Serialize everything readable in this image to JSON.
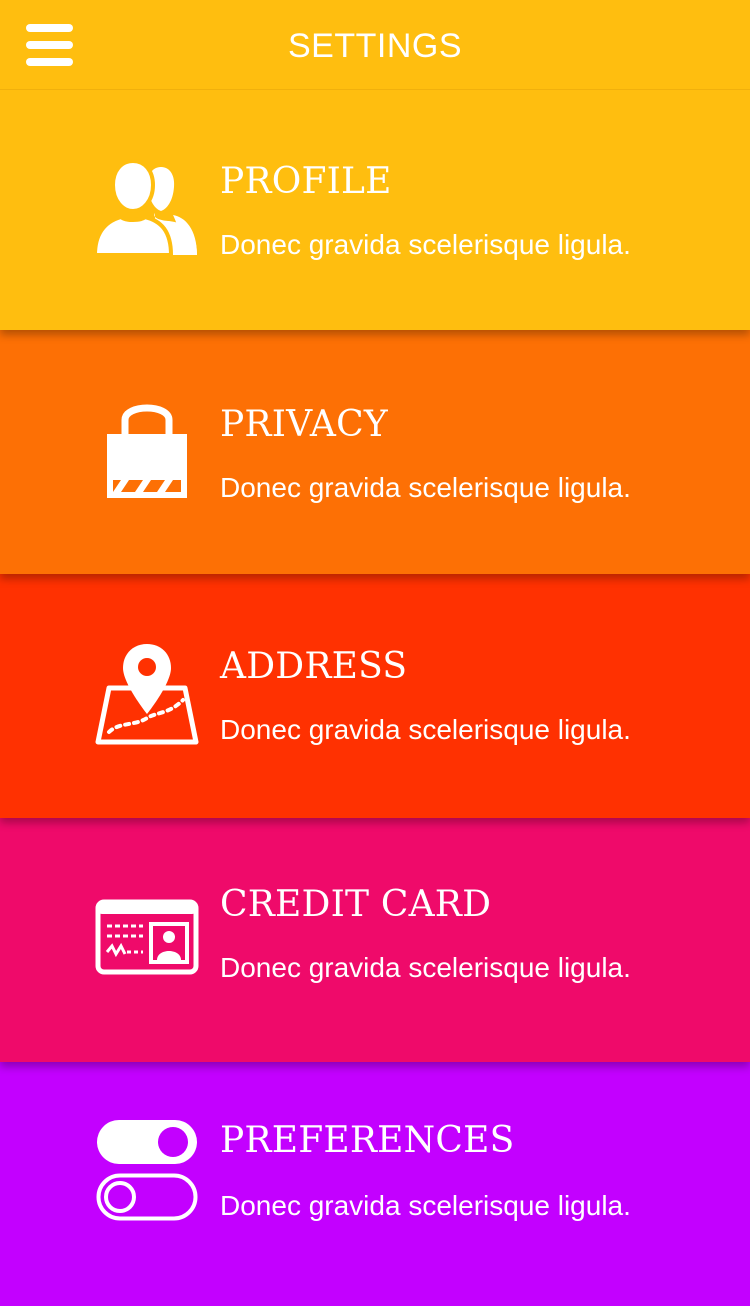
{
  "header": {
    "title": "SETTINGS",
    "menu_icon": "hamburger-menu-icon",
    "background": "#ffbe0f"
  },
  "items": [
    {
      "key": "profile",
      "title": "PROFILE",
      "subtitle": "Donec gravida scelerisque ligula.",
      "icon": "users-icon",
      "color": "#ffbe0f"
    },
    {
      "key": "privacy",
      "title": "PRIVACY",
      "subtitle": "Donec gravida scelerisque ligula.",
      "icon": "padlock-icon",
      "color": "#fd7005"
    },
    {
      "key": "address",
      "title": "ADDRESS",
      "subtitle": "Donec gravida scelerisque ligula.",
      "icon": "map-pin-icon",
      "color": "#ff3101"
    },
    {
      "key": "credit-card",
      "title": "CREDIT CARD",
      "subtitle": "Donec gravida scelerisque ligula.",
      "icon": "id-card-icon",
      "color": "#ef0a6a"
    },
    {
      "key": "preferences",
      "title": "PREFERENCES",
      "subtitle": "Donec gravida scelerisque ligula.",
      "icon": "toggles-icon",
      "color": "#c300ff"
    }
  ]
}
